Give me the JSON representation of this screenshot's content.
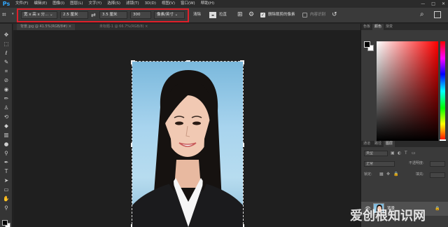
{
  "app": {
    "logo": "Ps"
  },
  "menu": [
    "文件(F)",
    "编辑(E)",
    "图像(I)",
    "图层(L)",
    "文字(Y)",
    "选择(S)",
    "滤镜(T)",
    "3D(D)",
    "视图(V)",
    "窗口(W)",
    "帮助(H)"
  ],
  "window_controls": {
    "minimize": "—",
    "maximize": "□",
    "close": "✕"
  },
  "options_bar": {
    "ratio_select": "宽 x 高 x 分... ⌄",
    "width_value": "2.5 厘米",
    "height_value": "3.5 厘米",
    "resolution_value": "300",
    "unit_select": "像素/英寸 ⌄",
    "clear_label": "清除",
    "straighten_label": "拉直",
    "delete_cropped_label": "删除裁剪的像素",
    "delete_cropped_checked": true,
    "content_aware_label": "内容识别",
    "content_aware_checked": false,
    "highlight_color": "#e0202a"
  },
  "document": {
    "tab_title": "背景.jpg @ 41.5%(RGB/8#) ×",
    "tab_title_2": "未标题-1 @ 66.7%(RGB/8) ×"
  },
  "toolbar": {
    "tools": [
      "move-icon",
      "marquee-icon",
      "lasso-icon",
      "quick-select-icon",
      "crop-icon",
      "eyedropper-icon",
      "healing-icon",
      "brush-icon",
      "stamp-icon",
      "history-brush-icon",
      "eraser-icon",
      "gradient-icon",
      "blur-icon",
      "dodge-icon",
      "pen-icon",
      "type-icon",
      "path-select-icon",
      "shape-icon",
      "hand-icon",
      "zoom-icon"
    ],
    "foreground_color": "#000000",
    "background_color": "#ffffff"
  },
  "panels": {
    "top_tabs": [
      "色板",
      "颜色",
      "渐变"
    ],
    "top_active": "颜色",
    "layer_tabs": [
      "通道",
      "路径",
      "图层"
    ],
    "layer_active": "图层",
    "kind_filter": "类型",
    "blend_mode": "正常",
    "opacity_label": "不透明度:",
    "lock_label": "锁定:",
    "fill_label": "填充:",
    "layers": [
      {
        "name": "背景",
        "visible": true,
        "locked": true
      }
    ]
  },
  "watermark": "爱创根知识网"
}
